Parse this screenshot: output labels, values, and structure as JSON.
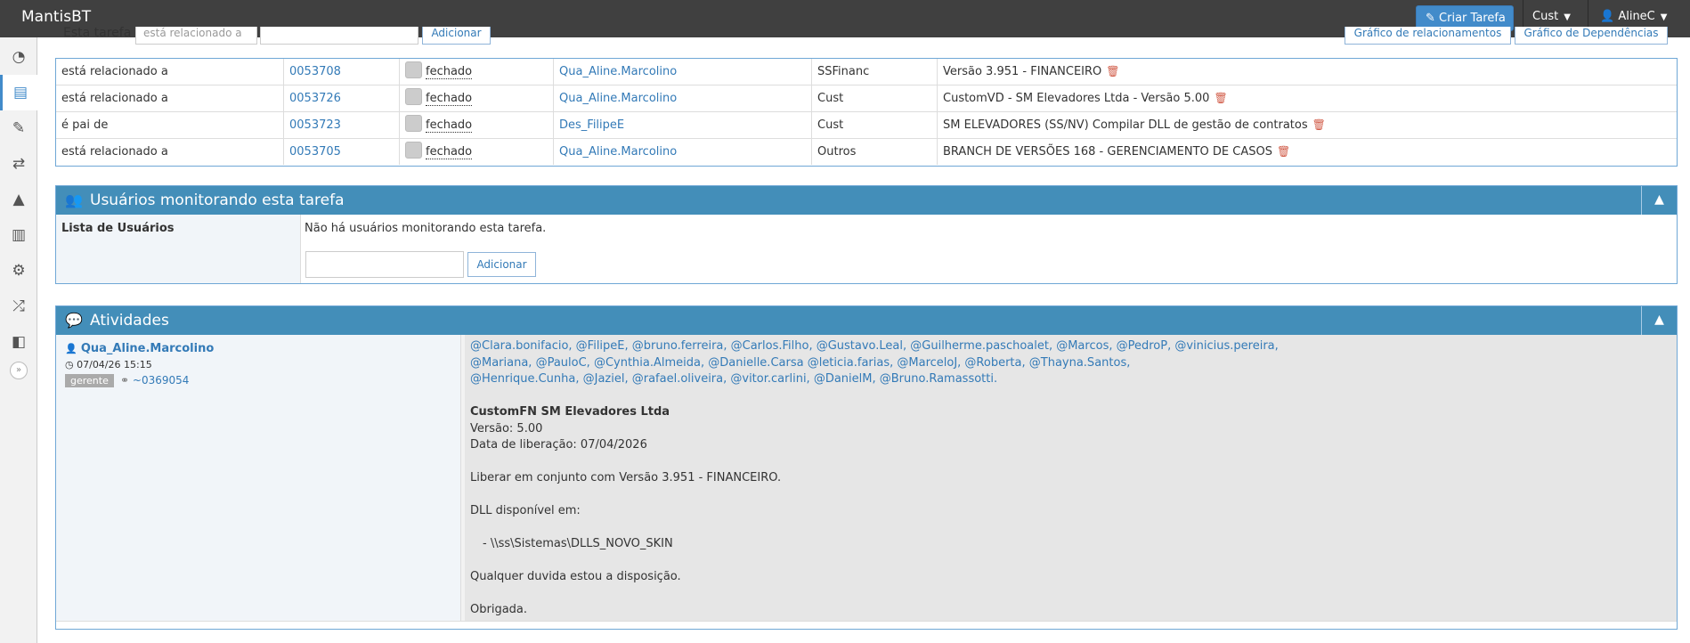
{
  "navbar": {
    "brand": "MantisBT",
    "create_button": "Criar Tarefa",
    "project": "Cust",
    "user": "AlineC"
  },
  "sidebar": {
    "items": [
      "dashboard-icon",
      "list-icon",
      "edit-icon",
      "retweet-icon",
      "road-icon",
      "chart-icon",
      "gears-icon",
      "random-icon",
      "book-icon"
    ],
    "toggle": "»"
  },
  "relations_toolbar": {
    "label": "Esta tarefa",
    "select_value": "está relacionado a",
    "add_button": "Adicionar",
    "graph_relations": "Gráfico de relacionamentos",
    "graph_dependencies": "Gráfico de Dependências"
  },
  "relations": [
    {
      "relation": "está relacionado a",
      "id": "0053708",
      "status": "fechado",
      "handler": "Qua_Aline.Marcolino",
      "project": "SSFinanc",
      "summary": "Versão 3.951 - FINANCEIRO"
    },
    {
      "relation": "está relacionado a",
      "id": "0053726",
      "status": "fechado",
      "handler": "Qua_Aline.Marcolino",
      "project": "Cust",
      "summary": "CustomVD - SM Elevadores Ltda - Versão 5.00"
    },
    {
      "relation": "é pai de",
      "id": "0053723",
      "status": "fechado",
      "handler": "Des_FilipeE",
      "project": "Cust",
      "summary": "SM ELEVADORES (SS/NV) Compilar DLL de gestão de contratos"
    },
    {
      "relation": "está relacionado a",
      "id": "0053705",
      "status": "fechado",
      "handler": "Qua_Aline.Marcolino",
      "project": "Outros",
      "summary": "BRANCH DE VERSÕES 168 - GERENCIAMENTO DE CASOS"
    }
  ],
  "monitoring": {
    "title": "Usuários monitorando esta tarefa",
    "label": "Lista de Usuários",
    "empty_text": "Não há usuários monitorando esta tarefa.",
    "add_button": "Adicionar"
  },
  "activities": {
    "title": "Atividades",
    "note": {
      "author": "Qua_Aline.Marcolino",
      "date": "07/04/26 15:15",
      "badge": "gerente",
      "ref": "~0369054",
      "mentions_line1": "@Clara.bonifacio, @FilipeE, @bruno.ferreira, @Carlos.Filho, @Gustavo.Leal, @Guilherme.paschoalet, @Marcos, @PedroP, @vinicius.pereira,",
      "mentions_line2": "@Mariana, @PauloC, @Cynthia.Almeida, @Danielle.Carsa @leticia.farias, @MarceloJ, @Roberta, @Thayna.Santos,",
      "mentions_line3": "@Henrique.Cunha, @Jaziel, @rafael.oliveira, @vitor.carlini, @DanielM, @Bruno.Ramassotti.",
      "heading": "CustomFN SM Elevadores Ltda",
      "version": "Versão: 5.00",
      "release_date": "Data de liberação: 07/04/2026",
      "release_note": "Liberar em conjunto com Versão 3.951 - FINANCEIRO.",
      "dll_label": "DLL disponível em:",
      "dll_path": "- \\\\ss\\Sistemas\\DLLS_NOVO_SKIN",
      "doubt": "Qualquer duvida estou a disposição.",
      "thanks": "Obrigada."
    }
  }
}
